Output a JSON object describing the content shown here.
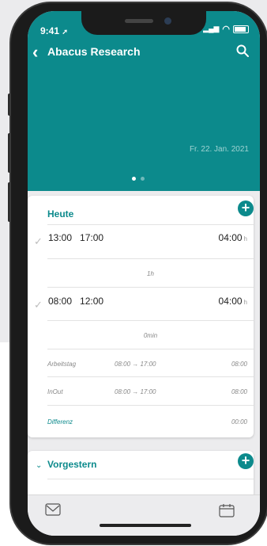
{
  "status_bar": {
    "time": "9:41",
    "signal": "▂▄▆",
    "wifi": "◠"
  },
  "nav": {
    "title": "Abacus Research"
  },
  "hero": {
    "date": "Fr. 22. Jan. 2021",
    "page_dots": 2,
    "active_dot": 0
  },
  "today": {
    "title": "Heute",
    "add_label": "+",
    "entries": [
      {
        "start": "13:00",
        "end": "17:00",
        "duration": "04:00",
        "unit": "h"
      },
      {
        "start": "08:00",
        "end": "12:00",
        "duration": "04:00",
        "unit": "h"
      }
    ],
    "breaks": [
      "1h",
      "0min"
    ],
    "summary": [
      {
        "label": "Arbeitstag",
        "range": "08:00 → 17:00",
        "value": "08:00"
      },
      {
        "label": "InOut",
        "range": "08:00 → 17:00",
        "value": "08:00"
      },
      {
        "label": "Differenz",
        "range": "",
        "value": "00:00"
      }
    ]
  },
  "previous": {
    "title": "Vorgestern",
    "add_label": "+"
  },
  "colors": {
    "accent": "#0c8a8c",
    "background": "#ececee"
  },
  "icons": {
    "back": "chevron-left-icon",
    "search": "search-icon",
    "mail": "mail-icon",
    "calendar": "calendar-icon",
    "expand": "chevron-down-icon"
  }
}
